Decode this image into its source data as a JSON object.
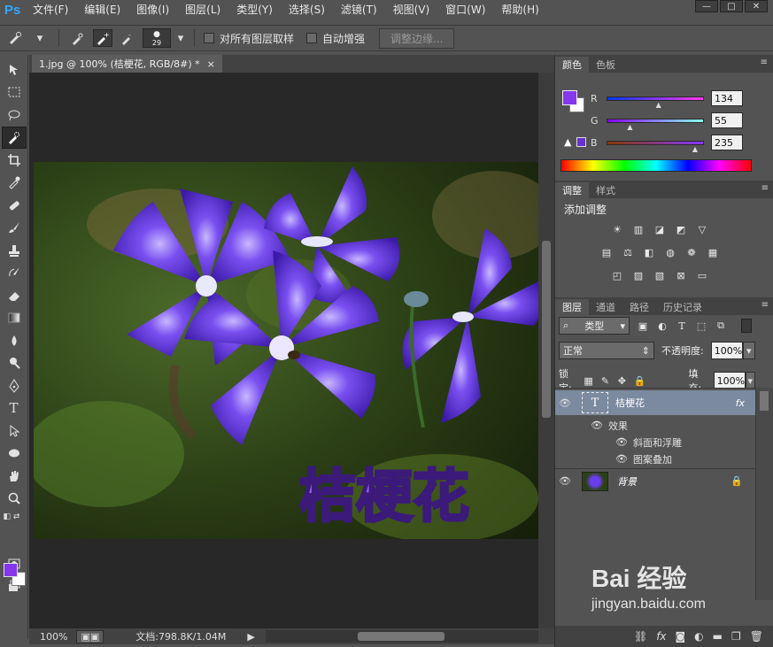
{
  "app": {
    "logo": "Ps"
  },
  "menu": [
    "文件(F)",
    "编辑(E)",
    "图像(I)",
    "图层(L)",
    "类型(Y)",
    "选择(S)",
    "滤镜(T)",
    "视图(V)",
    "窗口(W)",
    "帮助(H)"
  ],
  "window_controls": [
    "—",
    "□",
    "✕"
  ],
  "options": {
    "brush_size": "29",
    "sample_all_layers": "对所有图层取样",
    "auto_enhance": "自动增强",
    "refine_edge": "调整边缘..."
  },
  "document": {
    "tab_title": "1.jpg @ 100% (桔梗花, RGB/8#) *",
    "tab_close": "×",
    "zoom": "100%",
    "doc_info": "文档:798.8K/1.04M",
    "image_text": "桔梗花"
  },
  "color_panel": {
    "tabs": [
      "颜色",
      "色板"
    ],
    "r_label": "R",
    "g_label": "G",
    "b_label": "B",
    "r": "134",
    "g": "55",
    "b": "235",
    "foreground": "#8637eb"
  },
  "adjust_panel": {
    "tabs": [
      "调整",
      "样式"
    ],
    "title": "添加调整"
  },
  "layers_panel": {
    "tabs": [
      "图层",
      "通道",
      "路径",
      "历史记录"
    ],
    "filter_kind": "类型",
    "blend_mode": "正常",
    "opacity_label": "不透明度:",
    "opacity": "100%",
    "lock_label": "锁定:",
    "fill_label": "填充:",
    "fill": "100%",
    "layers": [
      {
        "name": "桔梗花",
        "type": "T",
        "fx": "fx"
      },
      {
        "name": "背景"
      }
    ],
    "effects_label": "效果",
    "effects": [
      "斜面和浮雕",
      "图案叠加"
    ]
  },
  "watermark": {
    "brand": "Bai 经验",
    "url": "jingyan.baidu.com"
  }
}
